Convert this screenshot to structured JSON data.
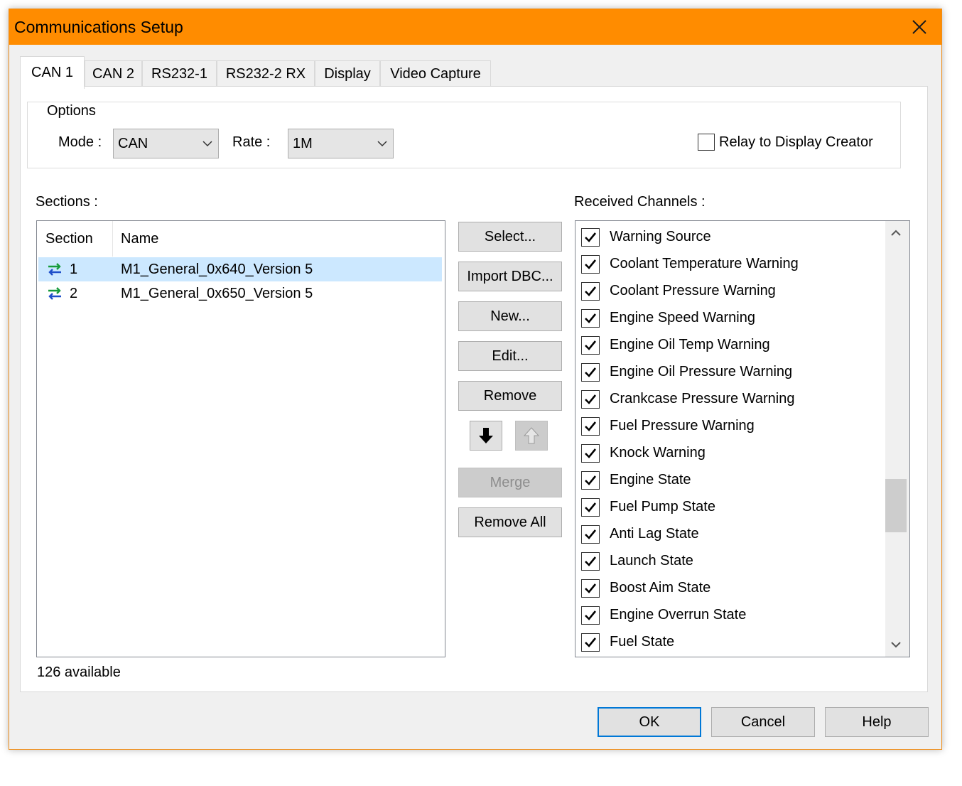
{
  "window": {
    "title": "Communications Setup"
  },
  "tabs": [
    {
      "label": "CAN 1",
      "active": true
    },
    {
      "label": "CAN 2"
    },
    {
      "label": "RS232-1"
    },
    {
      "label": "RS232-2 RX"
    },
    {
      "label": "Display"
    },
    {
      "label": "Video Capture"
    }
  ],
  "options": {
    "group_label": "Options",
    "mode_label": "Mode :",
    "mode_value": "CAN",
    "rate_label": "Rate :",
    "rate_value": "1M",
    "relay_label": "Relay to Display Creator",
    "relay_checked": false
  },
  "sections": {
    "label": "Sections :",
    "columns": [
      "Section",
      "Name"
    ],
    "rows": [
      {
        "section": "1",
        "name": "M1_General_0x640_Version 5",
        "selected": true
      },
      {
        "section": "2",
        "name": "M1_General_0x650_Version 5",
        "selected": false
      }
    ],
    "available": "126 available"
  },
  "buttons": {
    "select": "Select...",
    "import_dbc": "Import DBC...",
    "new": "New...",
    "edit": "Edit...",
    "remove": "Remove",
    "merge": "Merge",
    "remove_all": "Remove All"
  },
  "channels": {
    "label": "Received Channels :",
    "items": [
      "Warning Source",
      "Coolant Temperature Warning",
      "Coolant Pressure Warning",
      "Engine Speed Warning",
      "Engine Oil Temp Warning",
      "Engine Oil Pressure Warning",
      "Crankcase Pressure Warning",
      "Fuel Pressure Warning",
      "Knock Warning",
      "Engine State",
      "Fuel Pump State",
      "Anti Lag State",
      "Launch State",
      "Boost Aim State",
      "Engine Overrun State",
      "Fuel State"
    ]
  },
  "footer": {
    "ok": "OK",
    "cancel": "Cancel",
    "help": "Help"
  },
  "colors": {
    "titlebar": "#ff8c00",
    "selection": "#cce8ff",
    "focus": "#0078d7"
  }
}
